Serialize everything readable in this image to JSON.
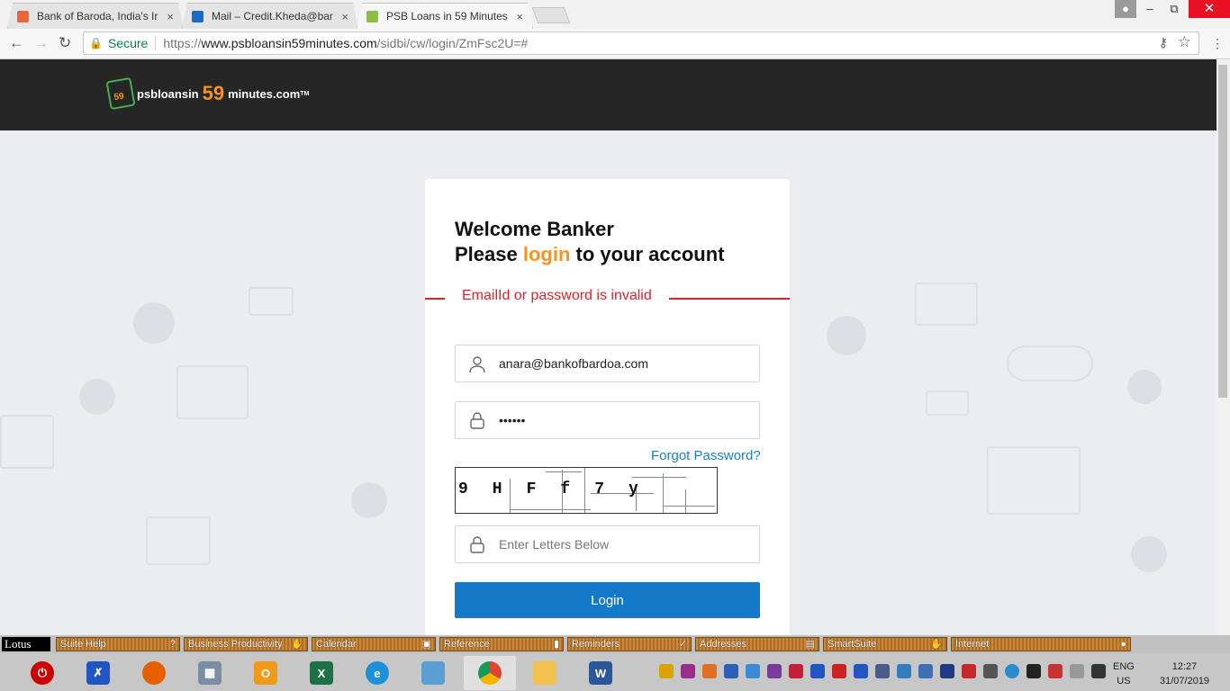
{
  "browser": {
    "tabs": [
      {
        "label": "Bank of Baroda, India's Ir",
        "icon": "bob-icon",
        "color": "#e8663a"
      },
      {
        "label": "Mail – Credit.Kheda@bar",
        "icon": "outlook-icon",
        "color": "#1b6ac9"
      },
      {
        "label": "PSB Loans in 59 Minutes",
        "icon": "psb-icon",
        "color": "#8cbf3f"
      }
    ],
    "close_glyph": "×",
    "secure_label": "Secure",
    "url_scheme": "https://",
    "url_host": "www.psbloansin59minutes.com",
    "url_path": "/sidbi/cw/login/ZmFsc2U=#"
  },
  "site": {
    "logo_small": "59",
    "logo_text_pre": "psbloansin",
    "logo_num": "59",
    "logo_text_post": "minutes.com",
    "logo_tm": "TM"
  },
  "login": {
    "title_line1": "Welcome Banker",
    "title_pre": "Please ",
    "title_highlight": "login",
    "title_post": " to your account",
    "error": "EmailId or password is invalid",
    "email_value": "anara@bankofbardoa.com",
    "password_value": "••••••",
    "forgot_label": "Forgot Password?",
    "captcha_text": "9HFf7y",
    "captcha_placeholder": "Enter Letters Below",
    "login_button": "Login"
  },
  "lotus": {
    "menu_label": "Lotus",
    "segments": [
      "Suite Help",
      "Business Productivity",
      "Calendar",
      "Reference",
      "Reminders",
      "Addresses",
      "SmartSuite",
      "Internet"
    ]
  },
  "taskbar": {
    "language": "ENG",
    "region": "US",
    "time": "12:27",
    "date": "31/07/2019"
  },
  "colors": {
    "accent_orange": "#f7941d",
    "error_red": "#e21f26",
    "button_blue": "#1479c9",
    "link_blue": "#1a7ec5"
  }
}
